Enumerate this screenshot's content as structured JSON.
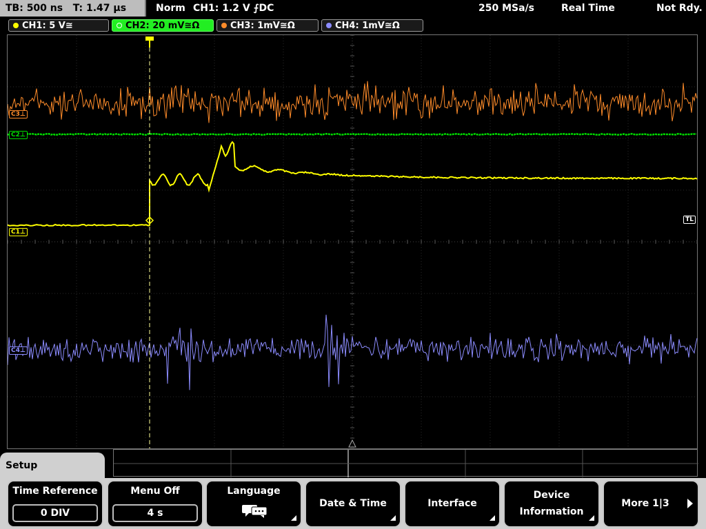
{
  "status": {
    "timebase": "TB: 500 ns",
    "trigger_time": "T: 1.47 µs",
    "mode": "Norm",
    "trigger_info": "CH1: 1.2 V ⨍DC",
    "sample_rate": "250 MSa/s",
    "acq_mode": "Real Time",
    "state": "Not Rdy."
  },
  "channels": [
    {
      "id": "ch1",
      "label": "CH1: 5 V≅",
      "color": "#ffff00",
      "marker": "C1⊥"
    },
    {
      "id": "ch2",
      "label": "CH2: 20 mV≅Ω",
      "color": "#00dd00",
      "marker": "C2⊥"
    },
    {
      "id": "ch3",
      "label": "CH3: 1mV≅Ω",
      "color": "#ff8c2a",
      "marker": "C3⊥"
    },
    {
      "id": "ch4",
      "label": "CH4: 1mV≅Ω",
      "color": "#8c8cff",
      "marker": "C4⊥"
    }
  ],
  "trigger_level_marker": "TL",
  "menu": {
    "title": "Setup",
    "softkeys": [
      {
        "id": "time-reference",
        "label": "Time Reference",
        "value": "0 DIV"
      },
      {
        "id": "menu-off",
        "label": "Menu Off",
        "value": "4 s"
      },
      {
        "id": "language",
        "label": "Language",
        "icon": "speech-bubble-icon"
      },
      {
        "id": "date-time",
        "label": "Date & Time"
      },
      {
        "id": "interface",
        "label": "Interface"
      },
      {
        "id": "device-information",
        "label_line1": "Device",
        "label_line2": "Information"
      },
      {
        "id": "more",
        "label": "More 1|3"
      }
    ]
  }
}
